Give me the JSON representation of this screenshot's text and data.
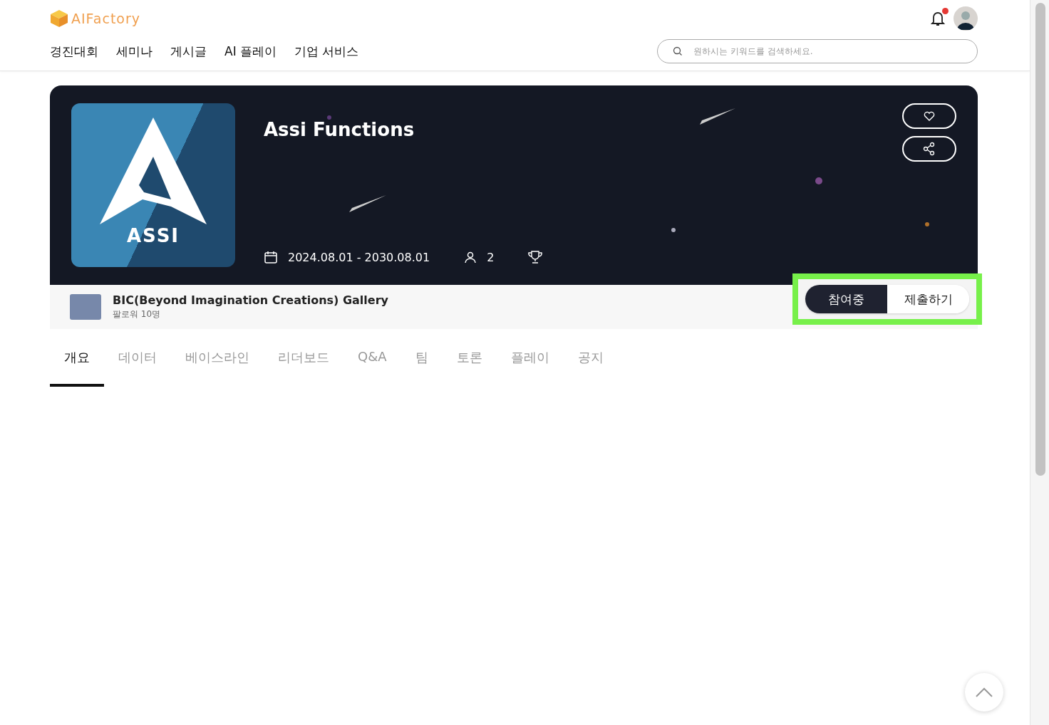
{
  "header": {
    "logo": "AIFactory",
    "notification": {
      "unread": true
    },
    "nav": [
      "경진대회",
      "세미나",
      "게시글",
      "AI 플레이",
      "기업 서비스"
    ],
    "search": {
      "placeholder": "원하시는 키워드를 검색하세요."
    }
  },
  "competition": {
    "title": "Assi Functions",
    "logo_text": "ASSI",
    "period": "2024.08.01 - 2030.08.01",
    "participants": "2"
  },
  "host": {
    "name": "BIC(Beyond Imagination Creations) Gallery",
    "followers": "팔로워 10명"
  },
  "actions": [
    {
      "label": "참여중",
      "selected": true
    },
    {
      "label": "제출하기",
      "selected": false
    }
  ],
  "tabs": [
    {
      "label": "개요",
      "selected": true
    },
    {
      "label": "데이터",
      "selected": false
    },
    {
      "label": "베이스라인",
      "selected": false
    },
    {
      "label": "리더보드",
      "selected": false
    },
    {
      "label": "Q&A",
      "selected": false
    },
    {
      "label": "팀",
      "selected": false
    },
    {
      "label": "토론",
      "selected": false
    },
    {
      "label": "플레이",
      "selected": false
    },
    {
      "label": "공지",
      "selected": false
    }
  ]
}
